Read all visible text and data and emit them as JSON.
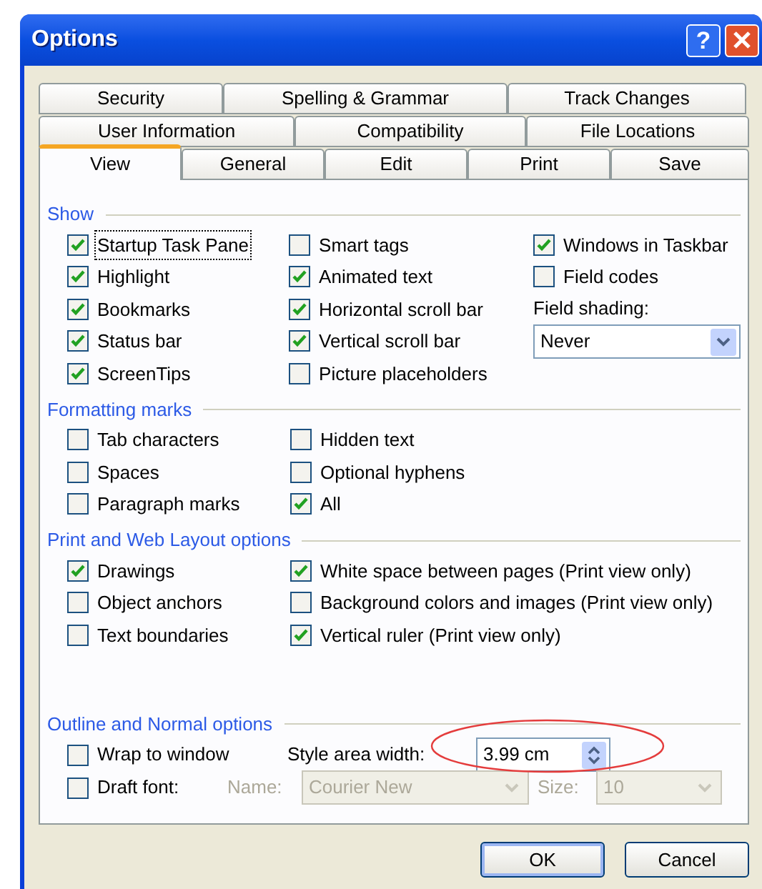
{
  "window": {
    "title": "Options",
    "help_button": "?"
  },
  "tab_rows": [
    {
      "tabs": [
        {
          "label": "Security",
          "selected": false
        },
        {
          "label": "Spelling & Grammar",
          "selected": false
        },
        {
          "label": "Track Changes",
          "selected": false
        }
      ]
    },
    {
      "tabs": [
        {
          "label": "User Information",
          "selected": false
        },
        {
          "label": "Compatibility",
          "selected": false
        },
        {
          "label": "File Locations",
          "selected": false
        }
      ]
    },
    {
      "tabs": [
        {
          "label": "View",
          "selected": true
        },
        {
          "label": "General",
          "selected": false
        },
        {
          "label": "Edit",
          "selected": false
        },
        {
          "label": "Print",
          "selected": false
        },
        {
          "label": "Save",
          "selected": false
        }
      ]
    }
  ],
  "sections": [
    {
      "title": "Show",
      "columns": [
        [
          {
            "kind": "checkbox",
            "label": "Startup Task Pane",
            "checked": true,
            "focused": true
          },
          {
            "kind": "checkbox",
            "label": "Highlight",
            "checked": true
          },
          {
            "kind": "checkbox",
            "label": "Bookmarks",
            "checked": true
          },
          {
            "kind": "checkbox",
            "label": "Status bar",
            "checked": true
          },
          {
            "kind": "checkbox",
            "label": "ScreenTips",
            "checked": true
          }
        ],
        [
          {
            "kind": "checkbox",
            "label": "Smart tags",
            "checked": false
          },
          {
            "kind": "checkbox",
            "label": "Animated text",
            "checked": true
          },
          {
            "kind": "checkbox",
            "label": "Horizontal scroll bar",
            "checked": true
          },
          {
            "kind": "checkbox",
            "label": "Vertical scroll bar",
            "checked": true
          },
          {
            "kind": "checkbox",
            "label": "Picture placeholders",
            "checked": false
          }
        ],
        [
          {
            "kind": "checkbox",
            "label": "Windows in Taskbar",
            "checked": true
          },
          {
            "kind": "checkbox",
            "label": "Field codes",
            "checked": false
          },
          {
            "kind": "label",
            "text": "Field shading:",
            "disabled": false
          },
          {
            "kind": "dropdown",
            "value": "Never",
            "disabled": false
          }
        ]
      ]
    },
    {
      "title": "Formatting marks",
      "columns": [
        [
          {
            "kind": "checkbox",
            "label": "Tab characters",
            "checked": false
          },
          {
            "kind": "checkbox",
            "label": "Spaces",
            "checked": false
          },
          {
            "kind": "checkbox",
            "label": "Paragraph marks",
            "checked": false
          }
        ],
        [
          {
            "kind": "checkbox",
            "label": "Hidden text",
            "checked": false
          },
          {
            "kind": "checkbox",
            "label": "Optional hyphens",
            "checked": false
          },
          {
            "kind": "checkbox",
            "label": "All",
            "checked": true
          }
        ]
      ]
    },
    {
      "title": "Print and Web Layout options",
      "columns": [
        [
          {
            "kind": "checkbox",
            "label": "Drawings",
            "checked": true
          },
          {
            "kind": "checkbox",
            "label": "Object anchors",
            "checked": false
          },
          {
            "kind": "checkbox",
            "label": "Text boundaries",
            "checked": false
          }
        ],
        [
          {
            "kind": "checkbox",
            "label": "White space between pages (Print view only)",
            "checked": true
          },
          {
            "kind": "checkbox",
            "label": "Background colors and images (Print view only)",
            "checked": false
          },
          {
            "kind": "checkbox",
            "label": "Vertical ruler (Print view only)",
            "checked": true
          }
        ]
      ]
    },
    {
      "title": "Outline and Normal options",
      "outline": {
        "wrap_to_window": {
          "kind": "checkbox",
          "label": "Wrap to window",
          "checked": false
        },
        "style_area_width": {
          "label": "Style area width:",
          "value": "3.99 cm"
        },
        "draft_font": {
          "kind": "checkbox",
          "label": "Draft font:",
          "checked": false
        },
        "font_name": {
          "label": "Name:",
          "value": "Courier New",
          "disabled": true
        },
        "font_size": {
          "label": "Size:",
          "value": "10",
          "disabled": true
        }
      }
    }
  ],
  "buttons": [
    {
      "label": "OK",
      "default": true
    },
    {
      "label": "Cancel",
      "default": false
    }
  ]
}
